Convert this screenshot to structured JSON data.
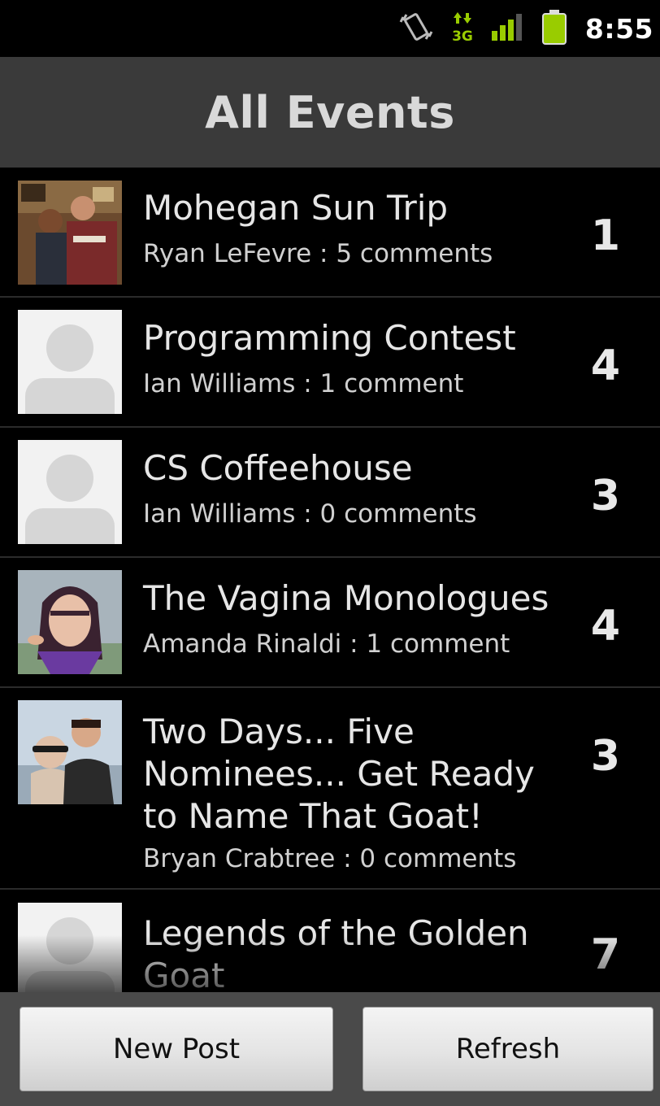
{
  "status_bar": {
    "time": "8:55",
    "icons": [
      "vibrate-icon",
      "3g-data-icon",
      "signal-strength-icon",
      "battery-icon"
    ],
    "network_label": "3G",
    "accent_color": "#99cc00"
  },
  "header": {
    "title": "All Events"
  },
  "events": [
    {
      "title": "Mohegan Sun Trip",
      "subtitle": "Ryan LeFevre : 5 comments",
      "count": "1",
      "thumbnail": "photo"
    },
    {
      "title": "Programming Contest",
      "subtitle": "Ian Williams : 1 comment",
      "count": "4",
      "thumbnail": "default-avatar"
    },
    {
      "title": "CS Coffeehouse",
      "subtitle": "Ian Williams : 0 comments",
      "count": "3",
      "thumbnail": "default-avatar"
    },
    {
      "title": "The Vagina Monologues",
      "subtitle": "Amanda Rinaldi : 1 comment",
      "count": "4",
      "thumbnail": "photo"
    },
    {
      "title": "Two Days...  Five Nominees... Get Ready to Name That Goat!",
      "subtitle": "Bryan Crabtree : 0 comments",
      "count": "3",
      "thumbnail": "photo"
    },
    {
      "title": "Legends of the Golden Goat",
      "subtitle": "",
      "count": "7",
      "thumbnail": "default-avatar"
    }
  ],
  "footer": {
    "new_post_label": "New Post",
    "refresh_label": "Refresh"
  }
}
